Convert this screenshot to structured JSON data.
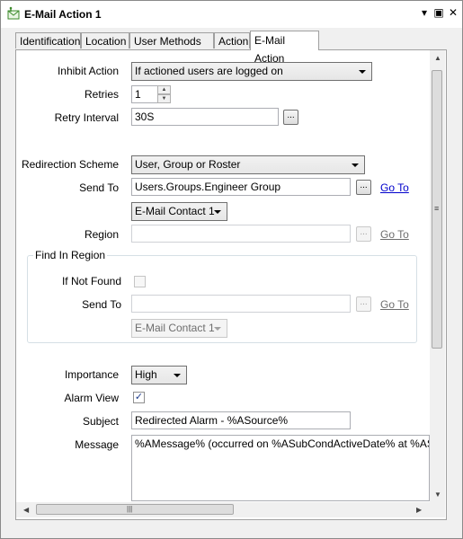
{
  "window": {
    "title": "E-Mail Action 1"
  },
  "titlebar": {
    "dropdown_glyph": "▾",
    "restore_glyph": "▣",
    "close_glyph": "✕"
  },
  "tabs": [
    {
      "label": "Identification"
    },
    {
      "label": "Location"
    },
    {
      "label": "User Methods"
    },
    {
      "label": "Action"
    },
    {
      "label": "E-Mail Action",
      "active": true
    }
  ],
  "form": {
    "inhibit_action": {
      "label": "Inhibit Action",
      "value": "If actioned users are logged on"
    },
    "retries": {
      "label": "Retries",
      "value": "1"
    },
    "retry_interval": {
      "label": "Retry Interval",
      "value": "30S",
      "browse": "..."
    },
    "redirection_scheme": {
      "label": "Redirection Scheme",
      "value": "User, Group or Roster"
    },
    "send_to": {
      "label": "Send To",
      "value": "Users.Groups.Engineer Group",
      "browse": "...",
      "goto": "Go To"
    },
    "contact": {
      "value": "E-Mail Contact 1"
    },
    "region": {
      "label": "Region",
      "value": "",
      "browse": "...",
      "goto": "Go To"
    },
    "find_in_region": {
      "title": "Find In Region",
      "if_not_found": {
        "label": "If Not Found",
        "checked": false
      },
      "send_to": {
        "label": "Send To",
        "value": "",
        "browse": "...",
        "goto": "Go To"
      },
      "contact": {
        "value": "E-Mail Contact 1"
      }
    },
    "importance": {
      "label": "Importance",
      "value": "High"
    },
    "alarm_view": {
      "label": "Alarm View",
      "checked": true,
      "mark": "✓"
    },
    "subject": {
      "label": "Subject",
      "value": "Redirected Alarm - %ASource%"
    },
    "message": {
      "label": "Message",
      "value": "%AMessage% (occurred on %ASubCondActiveDate% at %ASubCond"
    }
  },
  "scrollbars": {
    "up": "▲",
    "down": "▼",
    "left": "◀",
    "right": "▶",
    "grip_v": "≡",
    "grip_h": "|||"
  },
  "colors": {
    "link": "#0000cc",
    "border": "#a0a0a0"
  }
}
